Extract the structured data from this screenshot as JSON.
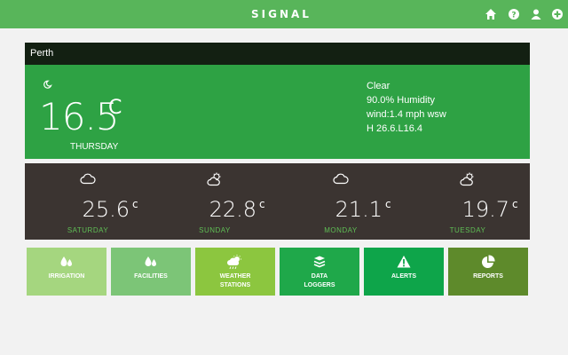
{
  "header": {
    "logo": "SIGNAL"
  },
  "city": "Perth",
  "current": {
    "temp": "16.5",
    "unit": "C",
    "day": "THURSDAY",
    "condition": "Clear",
    "humidity": "90.0% Humidity",
    "wind": "wind:1.4 mph wsw",
    "hilo": "H 26.6.L16.4"
  },
  "forecast": [
    {
      "temp": "25.6",
      "unit": "c",
      "day": "SATURDAY",
      "icon": "cloud-icon"
    },
    {
      "temp": "22.8",
      "unit": "c",
      "day": "SUNDAY",
      "icon": "partly-cloudy-icon"
    },
    {
      "temp": "21.1",
      "unit": "c",
      "day": "MONDAY",
      "icon": "cloud-icon"
    },
    {
      "temp": "19.7",
      "unit": "c",
      "day": "TUESDAY",
      "icon": "partly-cloudy-icon"
    }
  ],
  "tiles": [
    {
      "label": "IRRIGATION",
      "color": "#a5d67f",
      "icon": "water-drops-icon"
    },
    {
      "label": "FACILITIES",
      "color": "#7cc577",
      "icon": "water-drops-icon"
    },
    {
      "label": "WEATHER\nSTATIONS",
      "color": "#8cc63f",
      "icon": "weather-station-icon"
    },
    {
      "label": "DATA\nLOGGERS",
      "color": "#1fa84a",
      "icon": "database-icon"
    },
    {
      "label": "ALERTS",
      "color": "#0ea54a",
      "icon": "warning-icon"
    },
    {
      "label": "REPORTS",
      "color": "#5e8a2b",
      "icon": "pie-chart-icon"
    }
  ],
  "colors": {
    "topbar": "#58b55a",
    "current_bg": "#2ea244",
    "forecast_bg": "#3b3431",
    "city_bar": "#132012"
  }
}
